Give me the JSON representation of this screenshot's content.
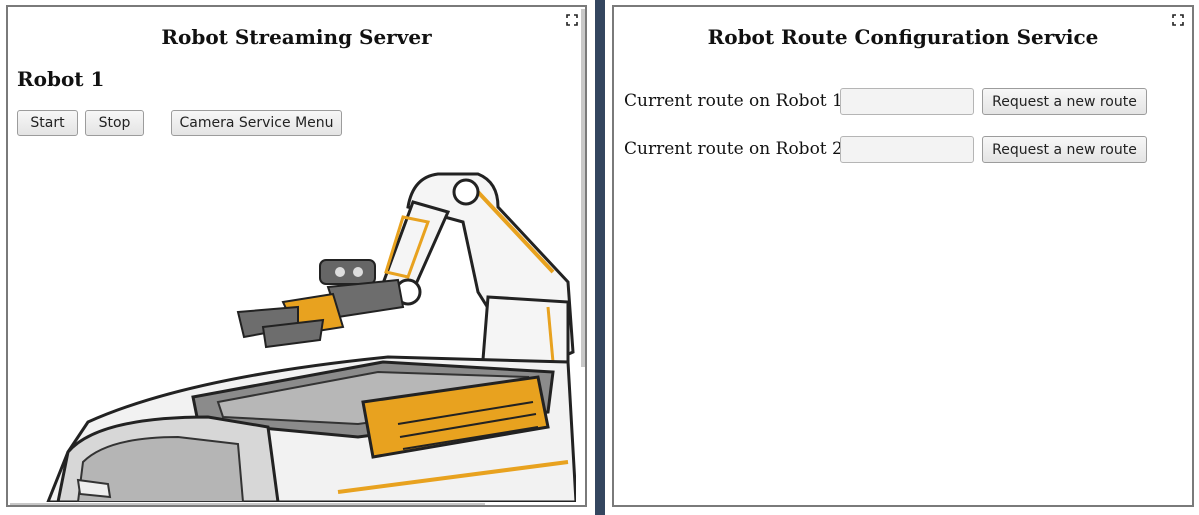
{
  "left_panel": {
    "title": "Robot Streaming Server",
    "robot_heading": "Robot 1",
    "buttons": {
      "start": "Start",
      "stop": "Stop",
      "camera_menu": "Camera Service Menu"
    },
    "image": "robot-arm-illustration"
  },
  "right_panel": {
    "title": "Robot Route Configuration Service",
    "routes": [
      {
        "label": "Current route on Robot 1:",
        "value": "",
        "button": "Request a new route"
      },
      {
        "label": "Current route on Robot 2:",
        "value": "",
        "button": "Request a new route"
      }
    ]
  },
  "icons": {
    "expand": "expand-icon"
  },
  "colors": {
    "divider": "#34465f",
    "accent": "#e8a21f"
  }
}
